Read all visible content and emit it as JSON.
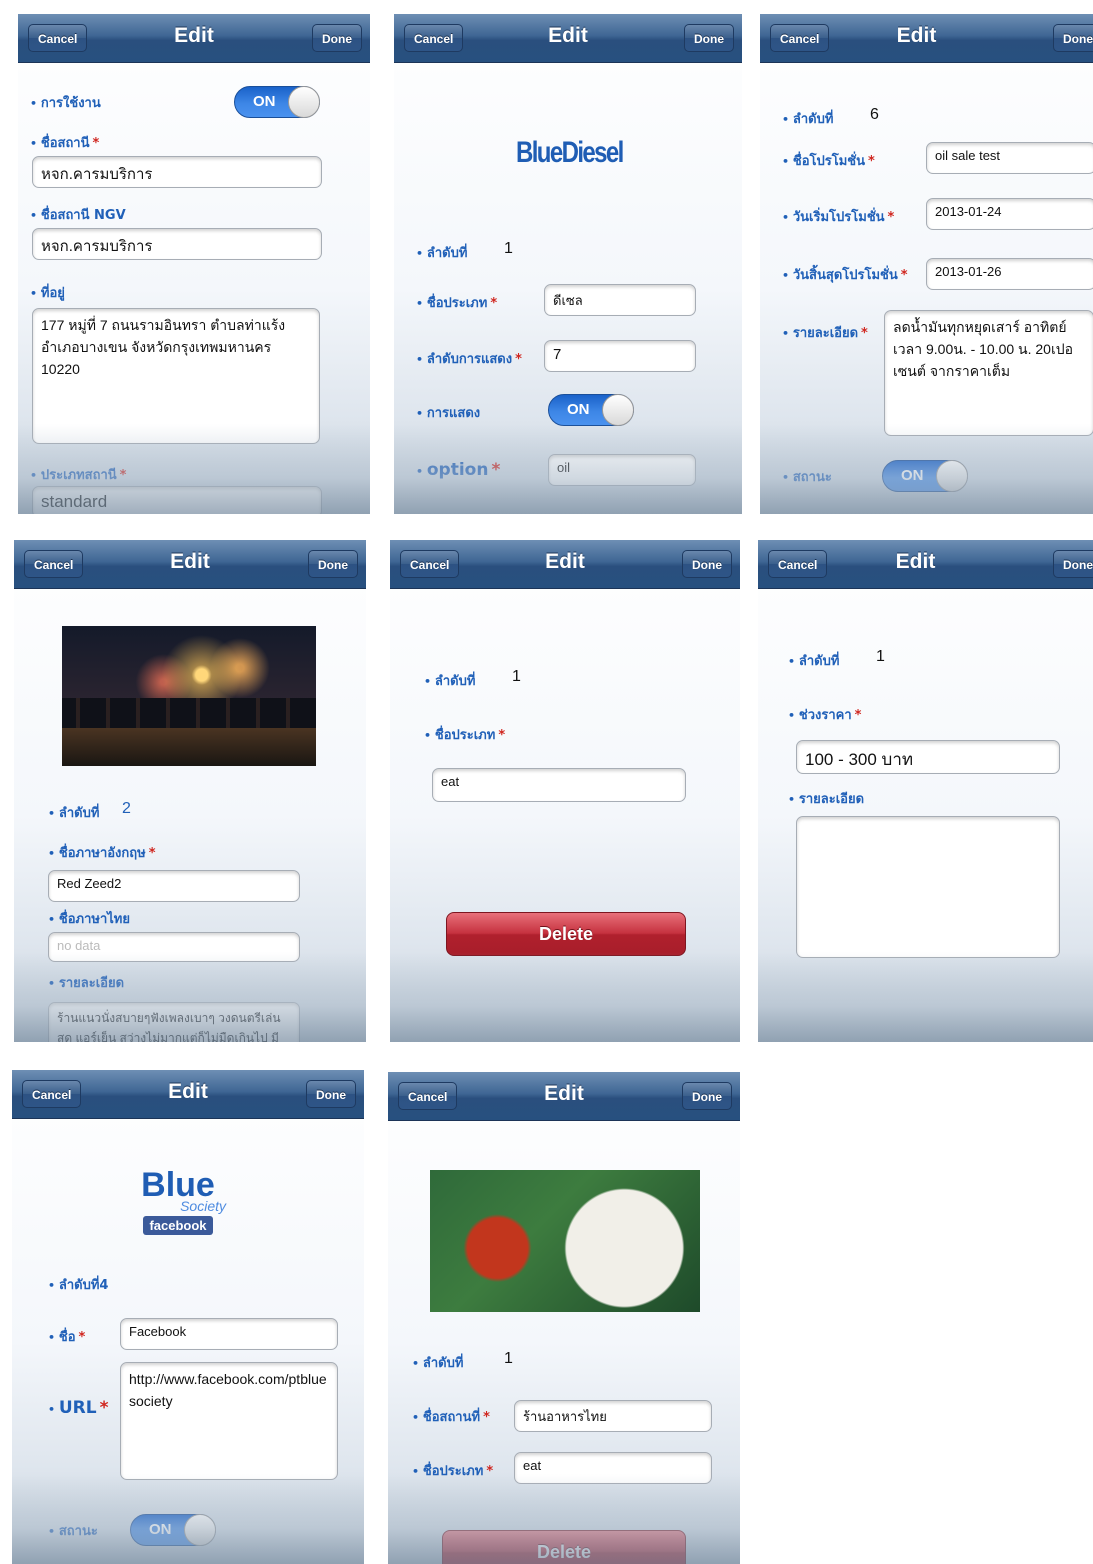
{
  "nav": {
    "cancel": "Cancel",
    "title": "Edit",
    "done": "Done"
  },
  "s1": {
    "usage_label": "การใช้งาน",
    "toggle": "ON",
    "station_name_label": "ชื่อสถานี",
    "station_name_value": "หจก.คารมบริการ",
    "ngv_label": "ชื่อสถานี NGV",
    "ngv_value": "หจก.คารมบริการ",
    "address_label": "ที่อยู่",
    "address_value": "177 หมู่ที่ 7 ถนนรามอินทรา ตำบลท่าแร้ง อำเภอบางเขน จังหวัดกรุงเทพมหานคร 10220",
    "type_label": "ประเภทสถานี",
    "type_value": "standard"
  },
  "s2": {
    "logo": "BlueDiesel",
    "order_label": "ลำดับที่",
    "order_value": "1",
    "type_label": "ชื่อประเภท",
    "type_value": "ดีเซล",
    "display_order_label": "ลำดับการแสดง",
    "display_order_value": "7",
    "display_label": "การแสดง",
    "toggle": "ON",
    "option_label": "option",
    "option_value": "oil"
  },
  "s3": {
    "order_label": "ลำดับที่",
    "order_value": "6",
    "promo_label": "ชื่อโปรโมชั่น",
    "promo_value": "oil sale test",
    "start_label": "วันเริ่มโปรโมชั่น",
    "start_value": "2013-01-24",
    "end_label": "วันสิ้นสุดโปรโมชั่น",
    "end_value": "2013-01-26",
    "detail_label": "รายละเอียด",
    "detail_value": "ลดน้ำมันทุกหยุดเสาร์ อาทิตย์ เวลา 9.00น. - 10.00 น. 20เปอเซนต์ จากราคาเต็ม",
    "status_label": "สถานะ",
    "toggle": "ON"
  },
  "s4": {
    "order_label": "ลำดับที่",
    "order_value": "2",
    "en_name_label": "ชื่อภาษาอังกฤษ",
    "en_name_value": "Red Zeed2",
    "th_name_label": "ชื่อภาษาไทย",
    "th_name_placeholder": "no data",
    "detail_label": "รายละเอียด",
    "detail_value": "ร้านแนวนั่งสบายๆฟังเพลงเบาๆ วงดนตรีเล่นสด แอร์เย็น สว่างไม่มากแต่ก็ไม่มืดเกินไป มี"
  },
  "s5": {
    "order_label": "ลำดับที่",
    "order_value": "1",
    "type_label": "ชื่อประเภท",
    "type_value": "eat",
    "delete": "Delete"
  },
  "s6": {
    "order_label": "ลำดับที่",
    "order_value": "1",
    "range_label": "ช่วงราคา",
    "range_value": "100 - 300 บาท",
    "detail_label": "รายละเอียด"
  },
  "s7": {
    "logo_line1": "Blue",
    "logo_line2": "Society",
    "logo_line3": "facebook",
    "order_label": "ลำดับที่4",
    "name_label": "ชื่อ",
    "name_value": "Facebook",
    "url_label": "URL",
    "url_value": "http://www.facebook.com/ptbluesociety",
    "status_label": "สถานะ",
    "toggle": "ON"
  },
  "s8": {
    "order_label": "ลำดับที่",
    "order_value": "1",
    "place_label": "ชื่อสถานที่",
    "place_value": "ร้านอาหารไทย",
    "type_label": "ชื่อประเภท",
    "type_value": "eat",
    "delete": "Delete"
  }
}
